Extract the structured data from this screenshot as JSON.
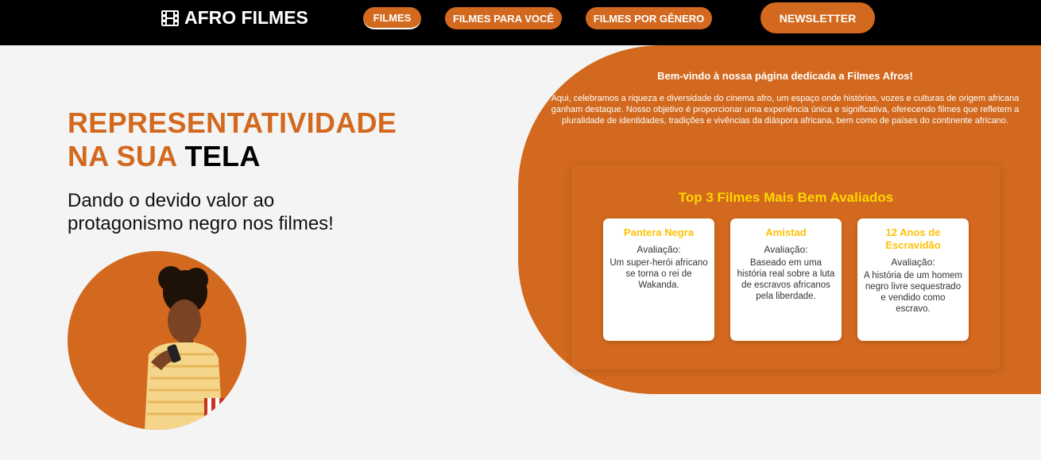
{
  "header": {
    "logo_text": "AFRO FILMES",
    "logo_icon": "film-icon",
    "nav": [
      {
        "label": "FILMES",
        "active": true
      },
      {
        "label": "FILMES PARA VOCÊ",
        "active": false
      },
      {
        "label": "FILMES POR GÊNERO",
        "active": false
      }
    ],
    "newsletter_label": "NEWSLETTER"
  },
  "hero": {
    "title_line1": "REPRESENTATIVIDADE",
    "title_line2_accent": "NA SUA",
    "title_line2_dark": "TELA",
    "subtitle": "Dando o devido valor ao protagonismo negro nos filmes!"
  },
  "welcome": {
    "heading": "Bem-vindo à nossa página dedicada a Filmes Afros!",
    "text": "Aqui, celebramos a riqueza e diversidade do cinema afro, um espaço onde histórias, vozes e culturas de origem africana ganham destaque. Nosso objetivo é proporcionar uma experiência única e significativa, oferecendo filmes que refletem a pluralidade de identidades, tradições e vivências da diáspora africana, bem como de países do continente africano."
  },
  "top3": {
    "title": "Top 3 Filmes Mais Bem Avaliados",
    "films": [
      {
        "title": "Pantera Negra",
        "rating_label": "Avaliação:",
        "description": "Um super-herói africano se torna o rei de Wakanda."
      },
      {
        "title": "Amistad",
        "rating_label": "Avaliação:",
        "description": "Baseado em uma história real sobre a luta de escravos africanos pela liberdade."
      },
      {
        "title": "12 Anos de Escravidão",
        "rating_label": "Avaliação:",
        "description": "A história de um homem negro livre sequestrado e vendido como escravo."
      }
    ]
  },
  "colors": {
    "accent": "#d2691e",
    "gold": "#ffc107",
    "header_bg": "#000000",
    "page_bg": "#f4f4f4"
  }
}
